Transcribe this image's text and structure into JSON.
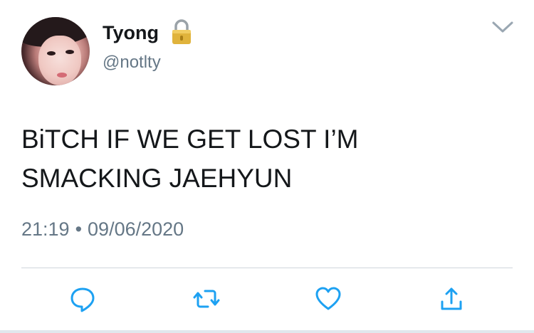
{
  "user": {
    "display_name": "Tyong",
    "handle": "@notlty",
    "avatar_icon": "profile-photo",
    "protected_icon": "lock-icon"
  },
  "tweet": {
    "text": "BiTCH IF WE GET LOST I’M\nSMACKING JAEHYUN",
    "time": "21:19",
    "separator": "•",
    "date": "09/06/2020"
  },
  "actions": {
    "reply_icon": "reply-icon",
    "retweet_icon": "retweet-icon",
    "like_icon": "heart-icon",
    "share_icon": "share-icon"
  },
  "colors": {
    "text": "#14171a",
    "secondary": "#657786",
    "icon_blue": "#1da1f2",
    "icon_gray": "#657786",
    "lock_gold": "#e0b33c"
  }
}
